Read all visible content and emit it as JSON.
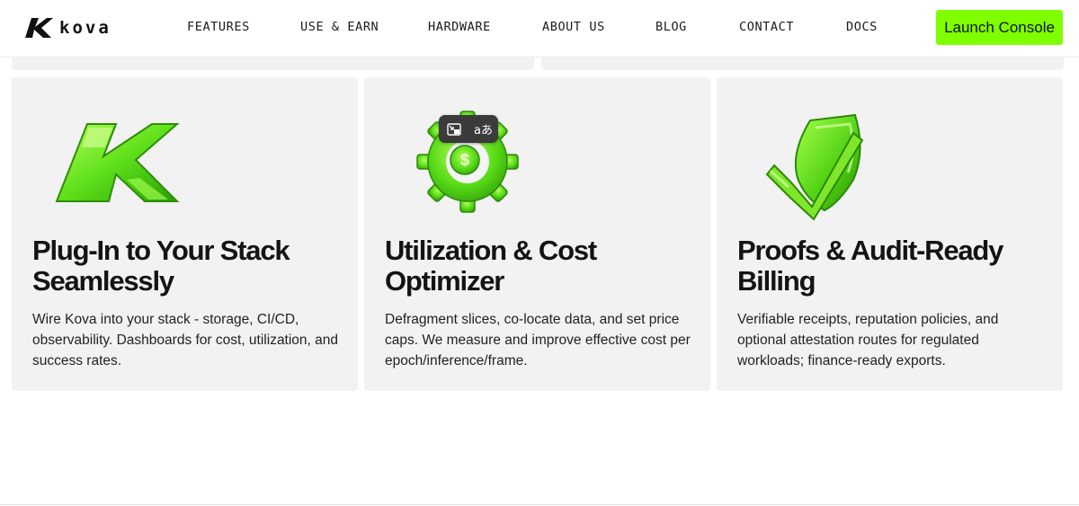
{
  "brand": {
    "name": "kova"
  },
  "nav": {
    "links": [
      "FEATURES",
      "USE & EARN",
      "HARDWARE",
      "ABOUT US",
      "BLOG",
      "CONTACT",
      "DOCS"
    ],
    "cta": "Launch Console"
  },
  "toolbar": {
    "translate_glyph": "aあ"
  },
  "cards": [
    {
      "title": "Plug-In to Your Stack Seamlessly",
      "text": "Wire Kova into your stack - storage, CI/CD, observability. Dashboards for cost, utilization, and success rates.",
      "icon": "kova-k-logo-icon"
    },
    {
      "title": "Utilization & Cost Optimizer",
      "text": "Defragment slices, co-locate data, and set price caps. We measure and improve effective cost per epoch/inference/frame.",
      "icon": "gear-dollar-icon"
    },
    {
      "title": "Proofs & Audit-Ready Billing",
      "text": "Verifiable receipts, reputation policies, and optional attestation routes for regulated workloads; finance-ready exports.",
      "icon": "shield-check-icon"
    }
  ],
  "colors": {
    "accent": "#7fff00",
    "card_bg": "#f2f2f2",
    "text": "#141414"
  }
}
